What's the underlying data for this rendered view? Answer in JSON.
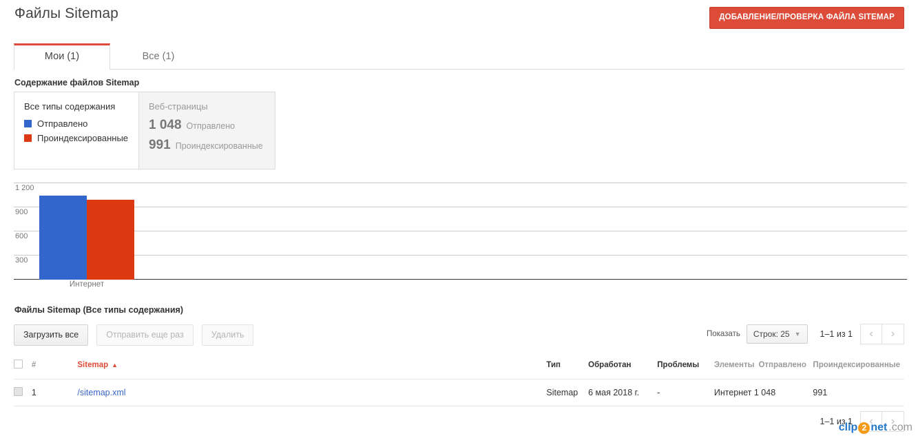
{
  "header": {
    "title": "Файлы Sitemap",
    "add_button": "ДОБАВЛЕНИЕ/ПРОВЕРКА ФАЙЛА SITEMAP"
  },
  "tabs": [
    {
      "label": "Мои (1)",
      "active": true
    },
    {
      "label": "Все (1)",
      "active": false
    }
  ],
  "content_summary": {
    "section_label": "Содержание файлов Sitemap",
    "card": {
      "title": "Все типы содержания",
      "legend": [
        {
          "label": "Отправлено",
          "color": "#3366cc"
        },
        {
          "label": "Проиндексированные",
          "color": "#dc3912"
        }
      ]
    },
    "panel": {
      "title": "Веб-страницы",
      "stats": [
        {
          "value": "1 048",
          "label": "Отправлено"
        },
        {
          "value": "991",
          "label": "Проиндексированные"
        }
      ]
    }
  },
  "chart_data": {
    "type": "bar",
    "title": "",
    "categories": [
      "Интернет"
    ],
    "series": [
      {
        "name": "Отправлено",
        "values": [
          1048
        ],
        "color": "#3366cc"
      },
      {
        "name": "Проиндексированные",
        "values": [
          991
        ],
        "color": "#dc3912"
      }
    ],
    "yticks": [
      "1 200",
      "900",
      "600",
      "300"
    ],
    "ytick_values": [
      1200,
      900,
      600,
      300
    ],
    "ylim": [
      0,
      1200
    ],
    "xlabel": "",
    "ylabel": "",
    "grid": true,
    "legend_position": "external-card"
  },
  "files_section": {
    "label": "Файлы Sitemap (Все типы содержания)",
    "toolbar": [
      {
        "label": "Загрузить все",
        "disabled": false
      },
      {
        "label": "Отправить еще раз",
        "disabled": true
      },
      {
        "label": "Удалить",
        "disabled": true
      }
    ],
    "pager": {
      "show_label": "Показать",
      "rows_select": "Строк: 25",
      "range": "1–1 из 1",
      "prev_icon": "chevron-left",
      "next_icon": "chevron-right"
    },
    "columns": [
      {
        "key": "num",
        "label": "#",
        "muted": true
      },
      {
        "key": "sitemap",
        "label": "Sitemap",
        "sorted": true,
        "sort_dir": "asc"
      },
      {
        "key": "type",
        "label": "Тип",
        "muted": false
      },
      {
        "key": "processed",
        "label": "Обработан",
        "muted": false
      },
      {
        "key": "problems",
        "label": "Проблемы",
        "muted": false
      },
      {
        "key": "elements",
        "label": "Элементы",
        "muted": true
      },
      {
        "key": "submitted",
        "label": "Отправлено",
        "muted": true
      },
      {
        "key": "indexed",
        "label": "Проиндексированные",
        "muted": true
      }
    ],
    "rows": [
      {
        "num": "1",
        "sitemap": "/sitemap.xml",
        "type": "Sitemap",
        "processed": "6 мая 2018 г.",
        "problems": "-",
        "elements": "Интернет 1 048",
        "submitted": "",
        "indexed": "991"
      }
    ]
  },
  "watermark": {
    "part1": "clip",
    "part2": "2",
    "part3": "net",
    "part4": ".com"
  }
}
